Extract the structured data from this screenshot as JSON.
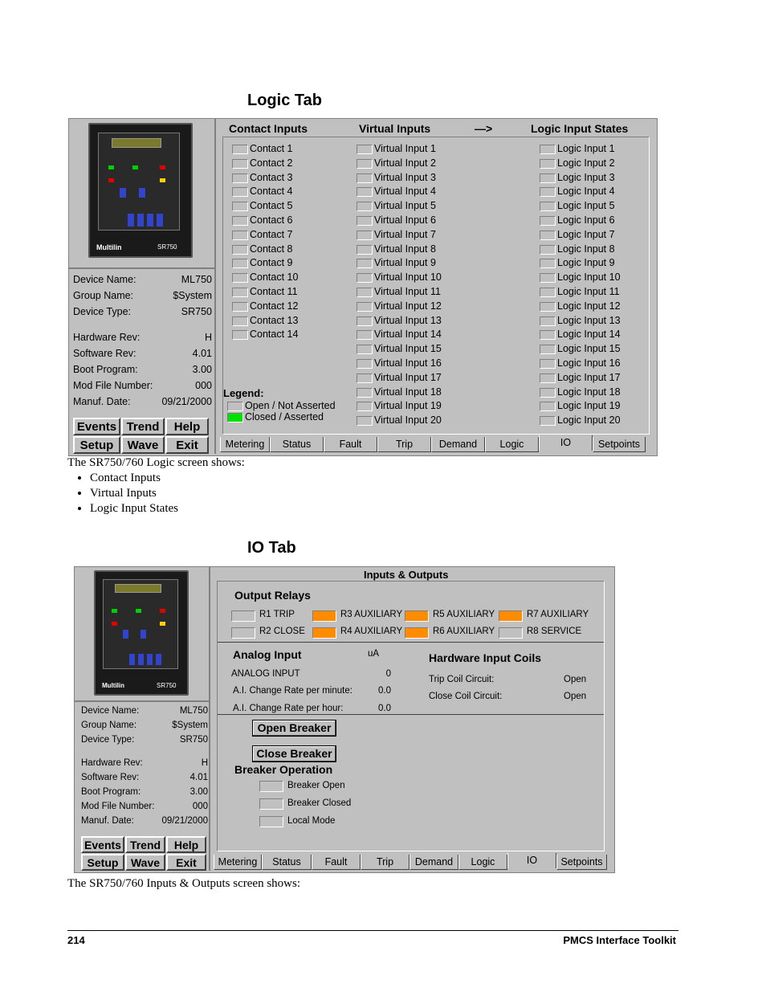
{
  "section1": {
    "heading": "Logic Tab",
    "caption": "The SR750/760 Logic screen shows:",
    "bullets": [
      "Contact Inputs",
      "Virtual Inputs",
      "Logic Input States"
    ]
  },
  "section2": {
    "heading": "IO Tab",
    "caption": "The SR750/760 Inputs & Outputs screen shows:"
  },
  "device": {
    "logo_text": "Multilin",
    "model_badge": "SR750",
    "info": [
      {
        "k": "Device Name:",
        "v": "ML750"
      },
      {
        "k": "Group Name:",
        "v": "$System"
      },
      {
        "k": "Device Type:",
        "v": "SR750"
      },
      {
        "k": "Hardware Rev:",
        "v": "H"
      },
      {
        "k": "Software Rev:",
        "v": "4.01"
      },
      {
        "k": "Boot Program:",
        "v": "3.00"
      },
      {
        "k": "Mod File Number:",
        "v": "000"
      },
      {
        "k": "Manuf. Date:",
        "v": "09/21/2000"
      }
    ],
    "buttons": [
      "Events",
      "Trend",
      "Help",
      "Setup",
      "Wave",
      "Exit"
    ]
  },
  "tabs": [
    "Metering",
    "Status",
    "Fault",
    "Trip",
    "Demand",
    "Logic",
    "IO",
    "Setpoints"
  ],
  "logic": {
    "headers": {
      "contact": "Contact Inputs",
      "virtual": "Virtual Inputs",
      "arrow": "—>",
      "logic": "Logic Input States"
    },
    "contacts": [
      "Contact 1",
      "Contact 2",
      "Contact 3",
      "Contact 4",
      "Contact 5",
      "Contact 6",
      "Contact 7",
      "Contact 8",
      "Contact 9",
      "Contact 10",
      "Contact 11",
      "Contact 12",
      "Contact 13",
      "Contact 14"
    ],
    "virtual": [
      "Virtual Input 1",
      "Virtual Input 2",
      "Virtual Input 3",
      "Virtual Input 4",
      "Virtual Input 5",
      "Virtual Input 6",
      "Virtual Input 7",
      "Virtual Input 8",
      "Virtual Input 9",
      "Virtual Input 10",
      "Virtual Input 11",
      "Virtual Input 12",
      "Virtual Input 13",
      "Virtual Input 14",
      "Virtual Input 15",
      "Virtual Input 16",
      "Virtual Input 17",
      "Virtual Input 18",
      "Virtual Input 19",
      "Virtual Input 20"
    ],
    "logic_inputs": [
      "Logic Input 1",
      "Logic Input 2",
      "Logic Input 3",
      "Logic Input 4",
      "Logic Input 5",
      "Logic Input 6",
      "Logic Input 7",
      "Logic Input 8",
      "Logic Input 9",
      "Logic Input 10",
      "Logic Input 11",
      "Logic Input 12",
      "Logic Input 13",
      "Logic Input 14",
      "Logic Input 15",
      "Logic Input 16",
      "Logic Input 17",
      "Logic Input 18",
      "Logic Input 19",
      "Logic Input 20"
    ],
    "legend": {
      "title": "Legend:",
      "open": "Open / Not Asserted",
      "closed": "Closed / Asserted"
    }
  },
  "io": {
    "title": "Inputs & Outputs",
    "relays_title": "Output Relays",
    "relays": [
      {
        "label": "R1  TRIP",
        "state": "off"
      },
      {
        "label": "R2  CLOSE",
        "state": "off"
      },
      {
        "label": "R3  AUXILIARY",
        "state": "on"
      },
      {
        "label": "R4  AUXILIARY",
        "state": "on"
      },
      {
        "label": "R5  AUXILIARY",
        "state": "on"
      },
      {
        "label": "R6  AUXILIARY",
        "state": "on"
      },
      {
        "label": "R7  AUXILIARY",
        "state": "on"
      },
      {
        "label": "R8  SERVICE",
        "state": "off"
      }
    ],
    "analog": {
      "title": "Analog Input",
      "unit": "uA",
      "rows": [
        {
          "k": "ANALOG INPUT",
          "v": "0"
        },
        {
          "k": "A.I. Change Rate per minute:",
          "v": "0.0"
        },
        {
          "k": "A.I. Change Rate per hour:",
          "v": "0.0"
        }
      ]
    },
    "coils": {
      "title": "Hardware Input Coils",
      "rows": [
        {
          "k": "Trip Coil Circuit:",
          "v": "Open"
        },
        {
          "k": "Close Coil Circuit:",
          "v": "Open"
        }
      ]
    },
    "open_breaker": "Open Breaker",
    "close_breaker": "Close Breaker",
    "breaker_op": {
      "title": "Breaker Operation",
      "items": [
        "Breaker Open",
        "Breaker Closed",
        "Local Mode"
      ]
    }
  },
  "footer": {
    "page": "214",
    "title": "PMCS Interface Toolkit"
  },
  "colors": {
    "panel": "#c0c0c0",
    "asserted": "#00e000",
    "relay_on": "#ff8c00"
  }
}
